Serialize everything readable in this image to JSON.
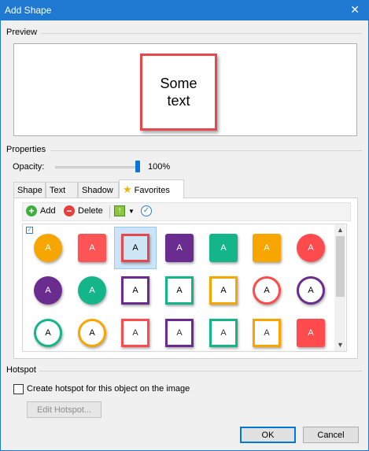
{
  "window": {
    "title": "Add Shape",
    "close_glyph": "✕"
  },
  "preview": {
    "group_label": "Preview",
    "sample_text": "Some text",
    "shape_color": "#e5484d"
  },
  "properties": {
    "group_label": "Properties",
    "opacity_label": "Opacity:",
    "opacity_value": "100%",
    "opacity_fraction": 1.0
  },
  "tabs": [
    {
      "label": "Shape",
      "active": false
    },
    {
      "label": "Text",
      "active": false
    },
    {
      "label": "Shadow",
      "active": false
    },
    {
      "label": "Favorites",
      "active": true,
      "icon": "star-icon"
    }
  ],
  "toolbar": {
    "add_label": "Add",
    "delete_label": "Delete",
    "add_icon": "plus-icon",
    "delete_icon": "minus-icon",
    "move_icon": "arrow-up-icon",
    "check_icon": "check-icon"
  },
  "favorites": {
    "select_all_icon": "checkbox-icon",
    "items": [
      {
        "label": "A",
        "shape": "circle",
        "style": "filled",
        "color": "#f7a600"
      },
      {
        "label": "A",
        "shape": "square",
        "style": "filled",
        "color": "#ff5456"
      },
      {
        "label": "A",
        "shape": "square",
        "style": "outline-filled",
        "color": "#e5484d",
        "selected": true
      },
      {
        "label": "A",
        "shape": "square",
        "style": "filled",
        "color": "#6a2d8f"
      },
      {
        "label": "A",
        "shape": "square",
        "style": "filled",
        "color": "#15b58a"
      },
      {
        "label": "A",
        "shape": "square",
        "style": "filled",
        "color": "#f7a600"
      },
      {
        "label": "A",
        "shape": "circle",
        "style": "filled",
        "color": "#ff4b4d"
      },
      {
        "label": "A",
        "shape": "circle",
        "style": "filled",
        "color": "#6a2d8f"
      },
      {
        "label": "A",
        "shape": "circle",
        "style": "filled",
        "color": "#15b58a"
      },
      {
        "label": "A",
        "shape": "square",
        "style": "outline",
        "color": "#6a2d8f"
      },
      {
        "label": "A",
        "shape": "square",
        "style": "outline",
        "color": "#15b58a"
      },
      {
        "label": "A",
        "shape": "square",
        "style": "outline",
        "color": "#f7a600"
      },
      {
        "label": "A",
        "shape": "circle",
        "style": "outline",
        "color": "#ff4b4d"
      },
      {
        "label": "A",
        "shape": "circle",
        "style": "outline",
        "color": "#6a2d8f"
      },
      {
        "label": "A",
        "shape": "circle",
        "style": "outline",
        "color": "#15b58a"
      },
      {
        "label": "A",
        "shape": "circle",
        "style": "outline",
        "color": "#f7a600"
      },
      {
        "label": "A",
        "shape": "square",
        "style": "outline-light",
        "color": "#ff4b4d"
      },
      {
        "label": "A",
        "shape": "square",
        "style": "outline-light",
        "color": "#6a2d8f"
      },
      {
        "label": "A",
        "shape": "square",
        "style": "outline-light",
        "color": "#15b58a"
      },
      {
        "label": "A",
        "shape": "square",
        "style": "outline-light",
        "color": "#f7a600"
      },
      {
        "label": "A",
        "shape": "square",
        "style": "filled",
        "color": "#ff4b4d"
      }
    ]
  },
  "hotspot": {
    "group_label": "Hotspot",
    "checkbox_label": "Create hotspot for this object on the image",
    "checked": false,
    "edit_button": "Edit Hotspot..."
  },
  "footer": {
    "ok_label": "OK",
    "cancel_label": "Cancel"
  }
}
